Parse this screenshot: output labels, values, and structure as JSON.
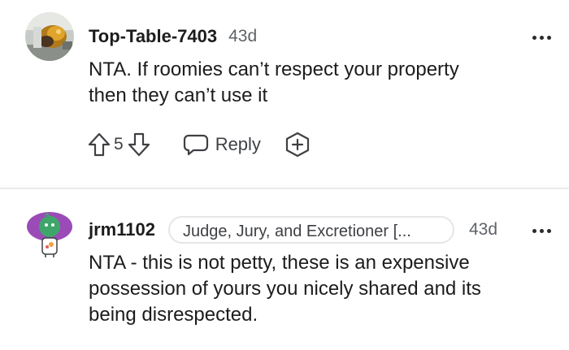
{
  "comments": [
    {
      "username": "Top-Table-7403",
      "time": "43d",
      "lines": [
        "NTA. If roomies can’t respect your property",
        "then they can’t use it"
      ],
      "votes": "5",
      "reply_label": "Reply"
    },
    {
      "username": "jrm1102",
      "flair": "Judge, Jury, and Excretioner [...",
      "time": "43d",
      "lines": [
        "NTA - this is not petty, these is an expensive",
        "possession of yours you nicely shared and its",
        "being disrespected."
      ]
    }
  ],
  "icons": {
    "upvote": "arrow-up-outline",
    "downvote": "arrow-down-outline",
    "reply": "speech-bubble",
    "award": "plus-circle",
    "more": "three-dots-horizontal"
  },
  "colors": {
    "text": "#1c1c1c",
    "muted": "#5f6368",
    "divider": "#ececec",
    "flair_border": "#e4e6e8",
    "avatar2_bg": "#9a4bb7"
  }
}
